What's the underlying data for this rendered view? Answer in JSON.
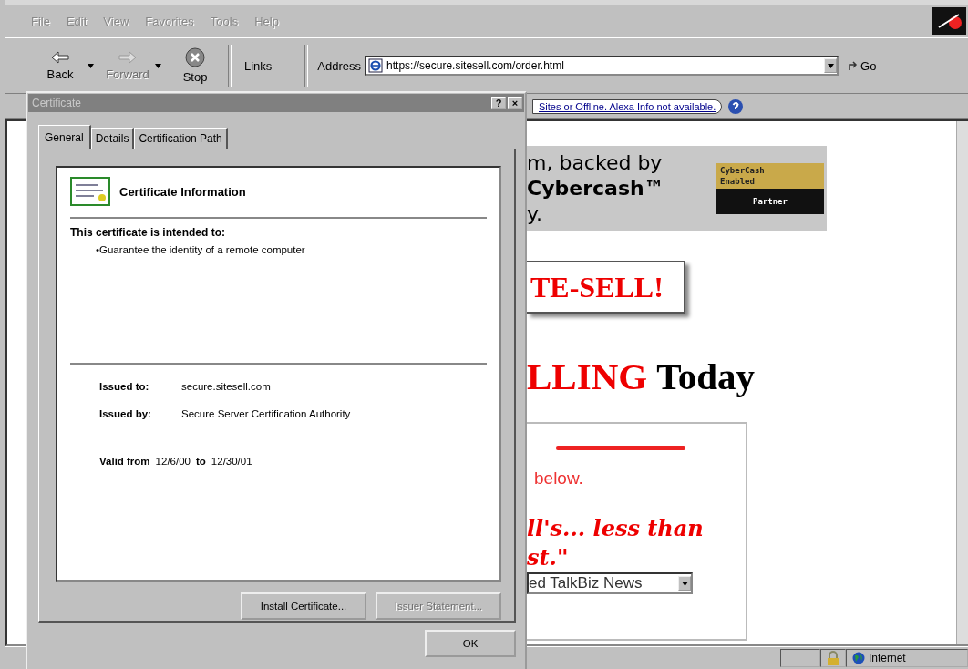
{
  "browser": {
    "menu": [
      "File",
      "Edit",
      "View",
      "Favorites",
      "Tools",
      "Help"
    ],
    "toolbar": [
      {
        "label": "Back",
        "kind": "back",
        "disabled": false
      },
      {
        "label": "Forward",
        "kind": "forward",
        "disabled": true
      },
      {
        "label": "Stop",
        "kind": "stop",
        "disabled": false
      }
    ],
    "links": "Links",
    "address_label": "Address",
    "address": "https://secure.sitesell.com/order.html",
    "go": "Go",
    "alexa_text": "Sites or Offline. Alexa Info not available.",
    "page": {
      "banner_lines": [
        "m, backed by",
        "Cybercash™",
        "y."
      ],
      "badge": [
        "CyberCash",
        "Enabled",
        "Partner"
      ],
      "logo": "TE-SELL!",
      "headline_red": "LLING",
      "headline": "Today",
      "note": "below.",
      "quote_lines": [
        "ll's... less than",
        "st.\""
      ],
      "select_value": "ed TalkBiz News"
    },
    "status": {
      "zone": "Internet"
    }
  },
  "dialog": {
    "title": "Certificate",
    "help_button": "?",
    "close_button": "×",
    "tabs": [
      {
        "label": "General",
        "selected": true
      },
      {
        "label": "Details",
        "selected": false
      },
      {
        "label": "Certification Path",
        "selected": false
      }
    ],
    "heading": "Certificate Information",
    "intended_label": "This certificate is intended to:",
    "purposes": [
      "•Guarantee the identity of a remote computer"
    ],
    "fields": [
      {
        "label": "Issued to:",
        "value": "secure.sitesell.com"
      },
      {
        "label": "Issued by:",
        "value": "Secure Server Certification Authority"
      }
    ],
    "valid": {
      "from_label": "Valid from",
      "from": "12/6/00",
      "to_label": "to",
      "to": "12/30/01"
    },
    "buttons": [
      {
        "label": "Install Certificate...",
        "disabled": false
      },
      {
        "label": "Issuer Statement...",
        "disabled": true
      }
    ],
    "ok": "OK"
  }
}
